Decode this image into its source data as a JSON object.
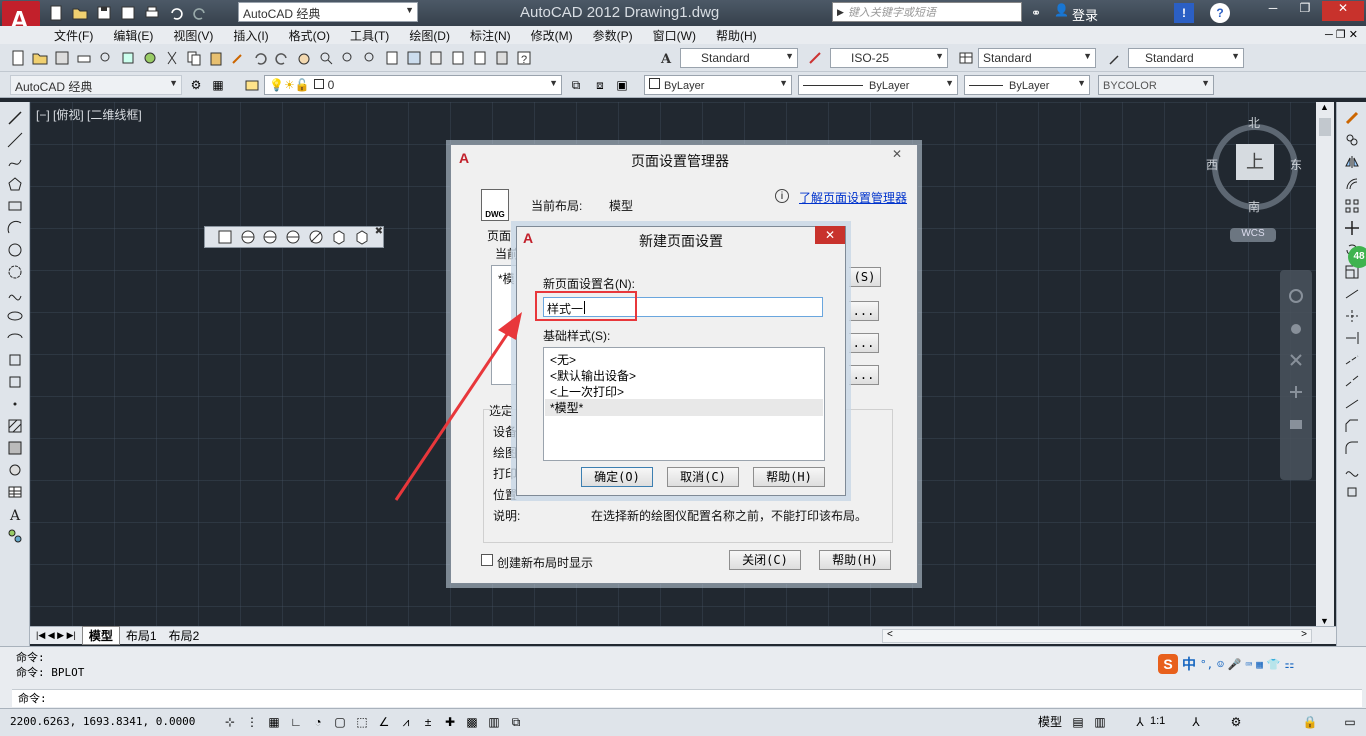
{
  "window": {
    "title": "AutoCAD 2012    Drawing1.dwg",
    "workspace": "AutoCAD 经典",
    "search_placeholder": "键入关键字或短语",
    "login": "登录",
    "help": "?"
  },
  "menu": [
    "文件(F)",
    "编辑(E)",
    "视图(V)",
    "插入(I)",
    "格式(O)",
    "工具(T)",
    "绘图(D)",
    "标注(N)",
    "修改(M)",
    "参数(P)",
    "窗口(W)",
    "帮助(H)"
  ],
  "toolbar1": {
    "text_style": "Standard",
    "dim_style": "ISO-25",
    "table_style": "Standard",
    "mleader_style": "Standard"
  },
  "toolbar2": {
    "workspace": "AutoCAD 经典",
    "layer": "0",
    "color": "ByLayer",
    "linetype": "ByLayer",
    "lineweight": "ByLayer",
    "plotstyle": "BYCOLOR"
  },
  "viewport": {
    "label": "[−] [俯视] [二维线框]",
    "viewcube": {
      "north": "北",
      "south": "南",
      "east": "东",
      "west": "西",
      "top": "上",
      "wcs": "WCS"
    }
  },
  "page_setup_manager": {
    "title": "页面设置管理器",
    "current_layout_label": "当前布局:",
    "current_layout_value": "模型",
    "learn_link": "了解页面设置管理器",
    "page_setup_label": "页面",
    "current_label": "当前",
    "list_item": "*模",
    "set_current_btn_tail": "(S)",
    "selected_label": "选定",
    "device_label": "设备",
    "plotter_label": "绘图",
    "print_size_label": "打印",
    "location_label": "位置",
    "description_label": "说明:",
    "description_value": "在选择新的绘图仪配置名称之前，不能打印该布局。",
    "show_on_create": "创建新布局时显示",
    "close_btn": "关闭(C)",
    "help_btn": "帮助(H)",
    "ellipsis": "..."
  },
  "new_page_setup": {
    "title": "新建页面设置",
    "name_label": "新页面设置名(N):",
    "name_value": "样式一",
    "base_label": "基础样式(S):",
    "base_items": [
      "<无>",
      "<默认输出设备>",
      "<上一次打印>",
      "*模型*"
    ],
    "ok": "确定(O)",
    "cancel": "取消(C)",
    "help": "帮助(H)"
  },
  "tabs": [
    "模型",
    "布局1",
    "布局2"
  ],
  "command": {
    "line1": "命令:",
    "line2": "命令: BPLOT",
    "prompt": "命令:"
  },
  "status": {
    "coords": "2200.6263, 1693.8341, 0.0000",
    "model": "模型",
    "scale": "1:1"
  },
  "ime": {
    "mode": "中",
    "badge": "48"
  },
  "colors": {
    "accent_red": "#e8373b",
    "link_blue": "#0033cc",
    "dialog_close_red": "#c8322c"
  }
}
